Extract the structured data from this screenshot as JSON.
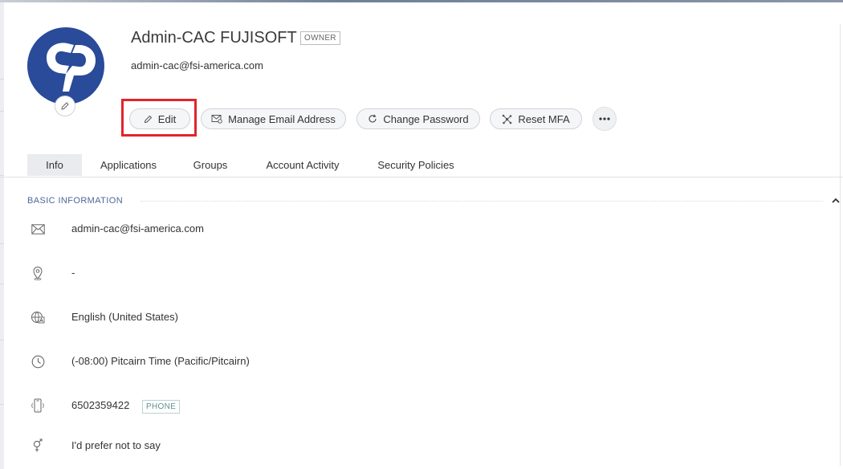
{
  "profile": {
    "name": "Admin-CAC FUJISOFT",
    "role_badge": "OWNER",
    "email": "admin-cac@fsi-america.com",
    "avatar_color": "#2a4a9a"
  },
  "actions": {
    "edit": "Edit",
    "manage_email": "Manage Email Address",
    "change_password": "Change Password",
    "reset_mfa": "Reset MFA",
    "more": "⋯"
  },
  "tabs": [
    {
      "label": "Info",
      "active": true
    },
    {
      "label": "Applications",
      "active": false
    },
    {
      "label": "Groups",
      "active": false
    },
    {
      "label": "Account Activity",
      "active": false
    },
    {
      "label": "Security Policies",
      "active": false
    }
  ],
  "basic_info": {
    "heading": "BASIC INFORMATION",
    "email": {
      "icon": "mail-icon",
      "value": "admin-cac@fsi-america.com"
    },
    "location": {
      "icon": "location-pin-icon",
      "value": "-"
    },
    "language": {
      "icon": "language-globe-icon",
      "value": "English (United States)"
    },
    "timezone": {
      "icon": "clock-icon",
      "value": "(-08:00) Pitcairn Time (Pacific/Pitcairn)"
    },
    "phone": {
      "icon": "mobile-phone-icon",
      "value": "6502359422",
      "badge": "PHONE"
    },
    "gender": {
      "icon": "gender-icon",
      "value": "I'd prefer not to say"
    }
  },
  "colors": {
    "accent_heading": "#4a6a9a",
    "highlight_box": "#e2242c",
    "phone_badge": "#5f8f8d"
  }
}
